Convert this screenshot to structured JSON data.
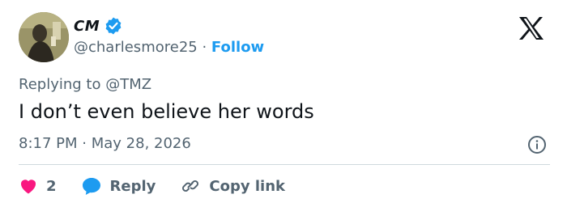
{
  "author": {
    "display_name": "CM",
    "handle": "@charlesmore25",
    "separator": "·",
    "follow_label": "Follow",
    "verified": true
  },
  "tweet": {
    "replying_to": "Replying to @TMZ",
    "text": "I don’t even believe her words",
    "time": "8:17 PM",
    "date": "May 28, 2026"
  },
  "actions": {
    "like_count": "2",
    "reply_label": "Reply",
    "copy_link_label": "Copy link"
  },
  "colors": {
    "brand_blue": "#1d9bf0",
    "like_red": "#f91880",
    "muted_text": "#536471"
  }
}
